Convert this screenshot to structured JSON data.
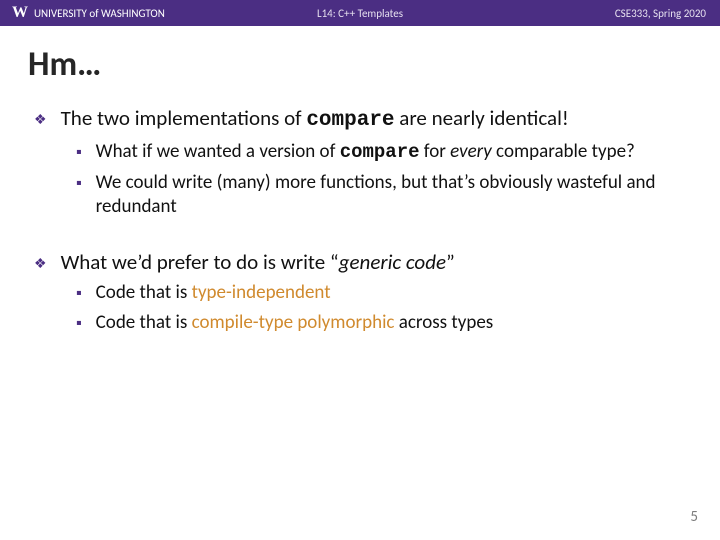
{
  "header": {
    "logo_letter": "W",
    "university": "UNIVERSITY of WASHINGTON",
    "lecture": "L14:  C++ Templates",
    "course": "CSE333, Spring 2020"
  },
  "title": "Hm…",
  "bullets": {
    "b1_pre": "The two implementations of ",
    "b1_code": "compare",
    "b1_post": " are nearly identical!",
    "b1a_pre": "What if we wanted a version of ",
    "b1a_code": "compare",
    "b1a_mid": " for ",
    "b1a_em": "every",
    "b1a_post": " comparable type?",
    "b1b": "We could write (many) more functions, but that’s obviously wasteful and redundant",
    "b2_pre": "What we’d prefer to do is write “",
    "b2_em": "generic code",
    "b2_post": "”",
    "b2a_pre": "Code that is ",
    "b2a_accent": "type-independent",
    "b2b_pre": "Code that is ",
    "b2b_accent": "compile-type polymorphic",
    "b2b_post": " across types"
  },
  "marks": {
    "l1": "❖",
    "l2": "▪"
  },
  "page": "5"
}
